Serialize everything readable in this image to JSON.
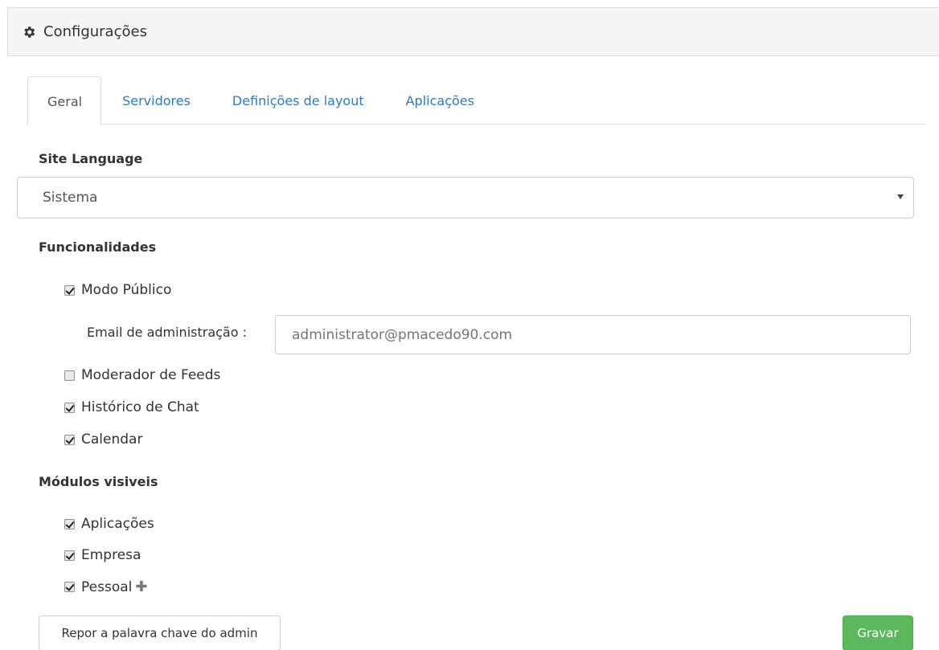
{
  "header": {
    "title": "Configurações",
    "icon": "gear-icon"
  },
  "tabs": [
    {
      "label": "Geral",
      "active": true
    },
    {
      "label": "Servidores",
      "active": false
    },
    {
      "label": "Definições de layout",
      "active": false
    },
    {
      "label": "Aplicações",
      "active": false
    }
  ],
  "site_language": {
    "label": "Site Language",
    "selected": "Sistema"
  },
  "features": {
    "label": "Funcionalidades",
    "public_mode": {
      "label": "Modo Público",
      "checked": true
    },
    "admin_email": {
      "label": "Email de administração :",
      "placeholder": "administrator@pmacedo90.com"
    },
    "feed_moderator": {
      "label": "Moderador de Feeds",
      "checked": false
    },
    "chat_history": {
      "label": "Histórico de Chat",
      "checked": true
    },
    "calendar": {
      "label": "Calendar",
      "checked": true
    }
  },
  "modules": {
    "label": "Módulos visiveis",
    "apps": {
      "label": "Aplicações",
      "checked": true
    },
    "company": {
      "label": "Empresa",
      "checked": true
    },
    "personal": {
      "label": "Pessoal",
      "checked": true
    }
  },
  "buttons": {
    "reset": "Repor a palavra chave do admin",
    "save": "Gravar"
  },
  "colors": {
    "link": "#337ab7",
    "save": "#5cb85c"
  }
}
